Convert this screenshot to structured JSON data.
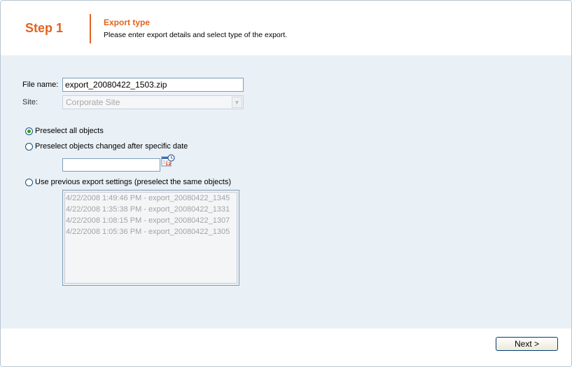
{
  "header": {
    "step": "Step 1",
    "title": "Export type",
    "description": "Please enter export details and select type of the export."
  },
  "form": {
    "file_name_label": "File name:",
    "file_name_value": "export_20080422_1503.zip",
    "site_label": "Site:",
    "site_value": "Corporate Site",
    "options": [
      {
        "label": "Preselect all objects",
        "checked": true
      },
      {
        "label": "Preselect objects changed after specific date",
        "checked": false
      },
      {
        "label": "Use previous export settings (preselect the same objects)",
        "checked": false
      }
    ],
    "date_value": "",
    "previous_exports": [
      "4/22/2008 1:49:46 PM - export_20080422_1345",
      "4/22/2008 1:35:38 PM - export_20080422_1331",
      "4/22/2008 1:08:15 PM - export_20080422_1307",
      "4/22/2008 1:05:36 PM - export_20080422_1305"
    ]
  },
  "footer": {
    "next_label": "Next >"
  },
  "colors": {
    "accent": "#e2631f",
    "content_bg": "#e9f0f6"
  },
  "icons": {
    "calendar": "calendar-icon",
    "dropdown": "chevron-down-icon"
  }
}
